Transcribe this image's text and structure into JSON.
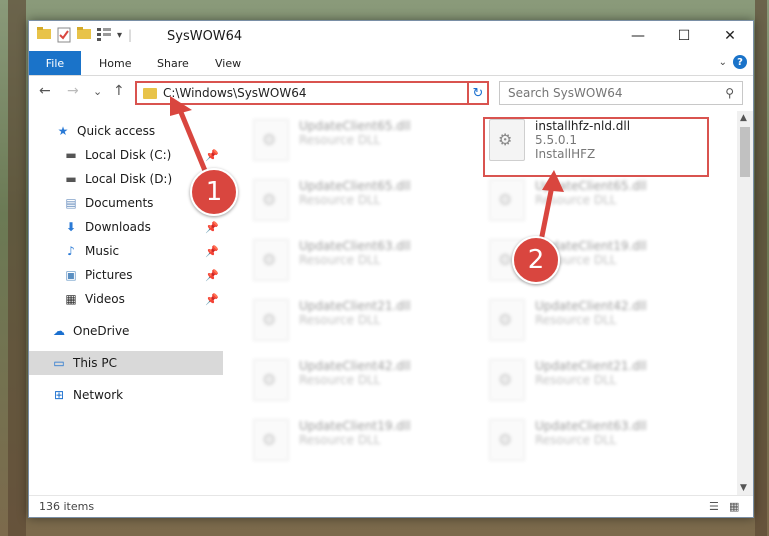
{
  "window": {
    "title": "SysWOW64",
    "minimize": "—",
    "maximize": "☐",
    "close": "✕"
  },
  "ribbon": {
    "file": "File",
    "tabs": [
      "Home",
      "Share",
      "View"
    ]
  },
  "nav": {
    "back": "←",
    "forward": "→",
    "recent": "⌄",
    "up": "↑",
    "address": "C:\\Windows\\SysWOW64",
    "refresh": "↻",
    "search_placeholder": "Search SysWOW64"
  },
  "sidebar": {
    "items": [
      {
        "label": "Quick access",
        "icon": "star-icon"
      },
      {
        "label": "Local Disk (C:)",
        "icon": "drive-icon"
      },
      {
        "label": "Local Disk (D:)",
        "icon": "drive-icon"
      },
      {
        "label": "Documents",
        "icon": "documents-icon"
      },
      {
        "label": "Downloads",
        "icon": "download-icon"
      },
      {
        "label": "Music",
        "icon": "music-icon"
      },
      {
        "label": "Pictures",
        "icon": "pictures-icon"
      },
      {
        "label": "Videos",
        "icon": "videos-icon"
      },
      {
        "label": "OneDrive",
        "icon": "cloud-icon"
      },
      {
        "label": "This PC",
        "icon": "computer-icon"
      },
      {
        "label": "Network",
        "icon": "network-icon"
      }
    ]
  },
  "files": {
    "highlighted": {
      "name": "installhfz-nld.dll",
      "version": "5.5.0.1",
      "company": "InstallHFZ"
    },
    "left": [
      {
        "name": "UpdateClient65.dll",
        "sub": "Resource DLL"
      },
      {
        "name": "UpdateClient65.dll",
        "sub": "Resource DLL"
      },
      {
        "name": "UpdateClient63.dll",
        "sub": "Resource DLL"
      },
      {
        "name": "UpdateClient21.dll",
        "sub": "Resource DLL"
      },
      {
        "name": "UpdateClient42.dll",
        "sub": "Resource DLL"
      },
      {
        "name": "UpdateClient19.dll",
        "sub": "Resource DLL"
      }
    ],
    "right": [
      {
        "name": "UpdateClient65.dll",
        "sub": "Resource DLL"
      },
      {
        "name": "UpdateClient19.dll",
        "sub": "Resource DLL"
      },
      {
        "name": "UpdateClient42.dll",
        "sub": "Resource DLL"
      },
      {
        "name": "UpdateClient21.dll",
        "sub": "Resource DLL"
      },
      {
        "name": "UpdateClient63.dll",
        "sub": "Resource DLL"
      }
    ]
  },
  "status": {
    "count": "136 items"
  },
  "annotations": {
    "step1": "1",
    "step2": "2",
    "color": "#d9463f"
  }
}
